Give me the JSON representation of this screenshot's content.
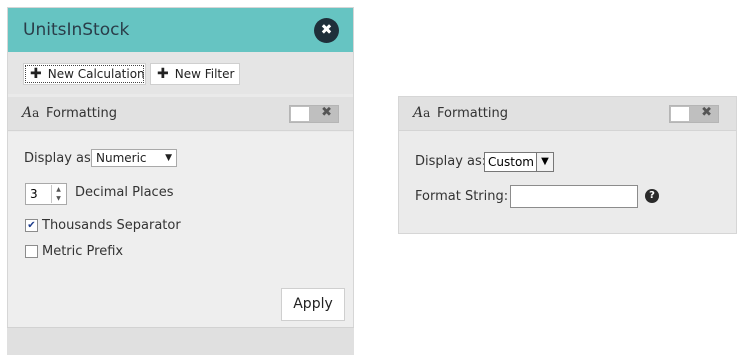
{
  "left_panel": {
    "title": "UnitsInStock",
    "close_symbol": "✖",
    "toolbar": {
      "new_calculation_label": "New Calculation",
      "new_filter_label": "New Filter"
    },
    "section": {
      "icon_big": "A",
      "icon_small": "a",
      "label": "Formatting",
      "toggle_x": "✖"
    },
    "display_as_label": "Display as:",
    "display_as_value": "Numeric",
    "decimal_places_value": "3",
    "decimal_places_label": "Decimal Places",
    "thousands_separator_label": "Thousands Separator",
    "thousands_separator_checked": true,
    "metric_prefix_label": "Metric Prefix",
    "metric_prefix_checked": false,
    "apply_label": "Apply"
  },
  "right_panel": {
    "section": {
      "icon_big": "A",
      "icon_small": "a",
      "label": "Formatting",
      "toggle_x": "✖"
    },
    "display_as_label": "Display as:",
    "display_as_value": "Custom",
    "format_string_label": "Format String:",
    "format_string_value": "",
    "help_symbol": "?"
  },
  "colors": {
    "header_teal": "#66c4c2",
    "panel_bg": "#eeeeee",
    "dark": "#1f2f3a"
  }
}
